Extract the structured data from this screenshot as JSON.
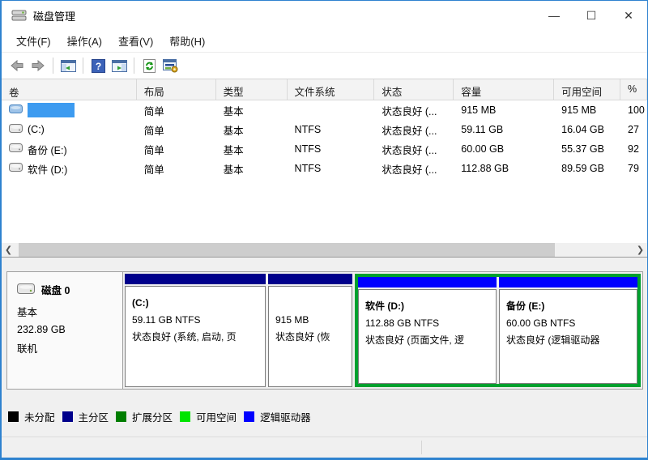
{
  "window": {
    "title": "磁盘管理",
    "controls": {
      "minimize": "—",
      "maximize": "☐",
      "close": "✕"
    }
  },
  "menu": {
    "items": [
      "文件(F)",
      "操作(A)",
      "查看(V)",
      "帮助(H)"
    ]
  },
  "toolbar": {
    "icons": [
      "back-icon",
      "forward-icon",
      "console-tree-icon",
      "help-icon",
      "action-pane-icon",
      "refresh-icon",
      "disk-settings-icon"
    ]
  },
  "volume_table": {
    "columns": [
      "卷",
      "布局",
      "类型",
      "文件系统",
      "状态",
      "容量",
      "可用空间",
      "%"
    ],
    "rows": [
      {
        "volume": "",
        "layout": "简单",
        "type": "基本",
        "fs": "",
        "status": "状态良好 (...",
        "capacity": "915 MB",
        "free": "915 MB",
        "pct": "100",
        "selected": true
      },
      {
        "volume": "(C:)",
        "layout": "简单",
        "type": "基本",
        "fs": "NTFS",
        "status": "状态良好 (...",
        "capacity": "59.11 GB",
        "free": "16.04 GB",
        "pct": "27",
        "selected": false
      },
      {
        "volume": "备份 (E:)",
        "layout": "简单",
        "type": "基本",
        "fs": "NTFS",
        "status": "状态良好 (...",
        "capacity": "60.00 GB",
        "free": "55.37 GB",
        "pct": "92",
        "selected": false
      },
      {
        "volume": "软件 (D:)",
        "layout": "简单",
        "type": "基本",
        "fs": "NTFS",
        "status": "状态良好 (...",
        "capacity": "112.88 GB",
        "free": "89.59 GB",
        "pct": "79",
        "selected": false
      }
    ]
  },
  "disk_panel": {
    "disk": {
      "name": "磁盘 0",
      "type": "基本",
      "size": "232.89 GB",
      "status": "联机"
    },
    "partitions": [
      {
        "name": "(C:)",
        "size": "59.11 GB NTFS",
        "status": "状态良好 (系统, 启动, 页",
        "kind": "primary"
      },
      {
        "name": "",
        "size": "915 MB",
        "status": "状态良好 (恢",
        "kind": "primary-hatched"
      },
      {
        "name": "软件  (D:)",
        "size": "112.88 GB NTFS",
        "status": "状态良好 (页面文件, 逻",
        "kind": "logical"
      },
      {
        "name": "备份  (E:)",
        "size": "60.00 GB NTFS",
        "status": "状态良好 (逻辑驱动器",
        "kind": "logical"
      }
    ]
  },
  "legend": {
    "items": [
      {
        "label": "未分配",
        "color": "#000000"
      },
      {
        "label": "主分区",
        "color": "#00008b"
      },
      {
        "label": "扩展分区",
        "color": "#007e00"
      },
      {
        "label": "可用空间",
        "color": "#00e400"
      },
      {
        "label": "逻辑驱动器",
        "color": "#0000ff"
      }
    ]
  },
  "colors": {
    "window_border": "#2e82cf",
    "selection": "#3d9bf0",
    "primary_bar": "#00008b",
    "logical_bar": "#0000ff",
    "extended_frame": "#00a02e"
  }
}
